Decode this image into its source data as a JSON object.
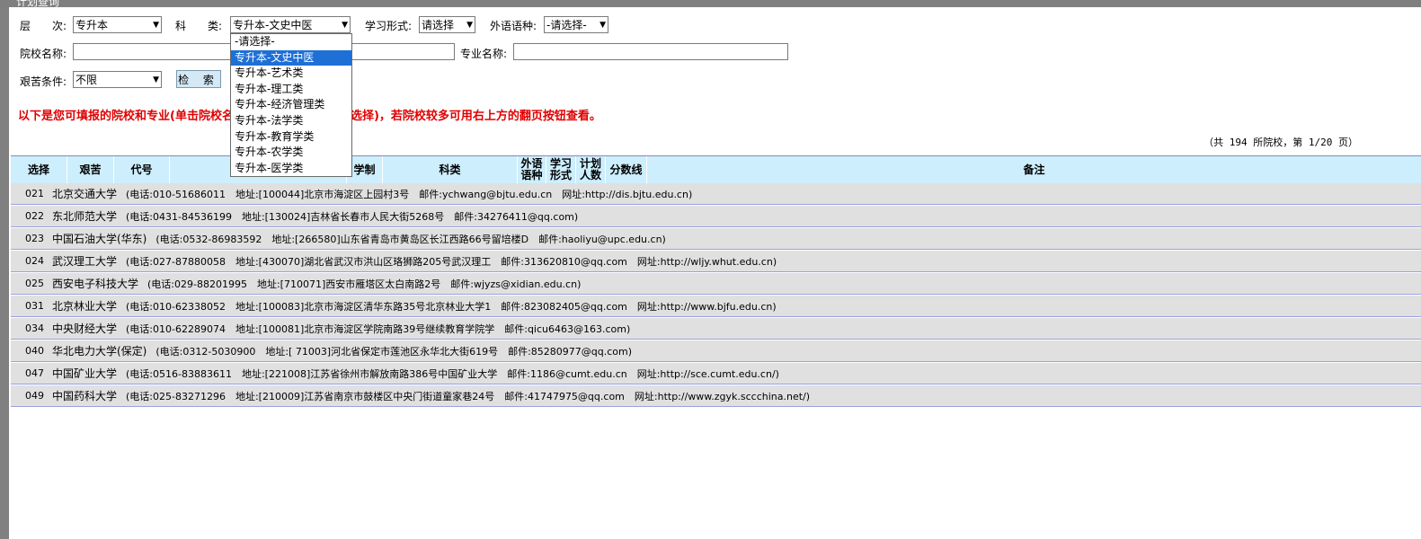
{
  "window_title": "计划查询",
  "filters": {
    "level_label": "层　　次:",
    "level_value": "专升本",
    "category_label": "科　　类:",
    "category_value": "专升本-文史中医",
    "study_form_label": "学习形式:",
    "study_form_value": "请选择",
    "language_label": "外语语种:",
    "language_value": "-请选择-",
    "school_label": "院校名称:",
    "school_value": "",
    "major_label": "专业名称:",
    "major_value": "",
    "hardship_label": "艰苦条件:",
    "hardship_value": "不限",
    "search_button": "检 索"
  },
  "category_options": [
    "-请选择-",
    "专升本-文史中医",
    "专升本-艺术类",
    "专升本-理工类",
    "专升本-经济管理类",
    "专升本-法学类",
    "专升本-教育学类",
    "专升本-农学类",
    "专升本-医学类"
  ],
  "selected_option_index": 1,
  "notice": "以下是您可填报的院校和专业(单击院校名称查看专业，双击专业选择)，若院校较多可用右上方的翻页按钮查看。",
  "page_info": "（共 194 所院校，第 1/20 页）",
  "table": {
    "headers": [
      "选择",
      "艰苦",
      "代号",
      "",
      "学制",
      "科类",
      "外语\n语种",
      "学习\n形式",
      "计划\n人数",
      "分数线",
      "备注"
    ],
    "rows": [
      {
        "code": "021",
        "name": "北京交通大学",
        "info": "(电话:010-51686011　地址:[100044]北京市海淀区上园村3号　邮件:ychwang@bjtu.edu.cn　网址:http://dis.bjtu.edu.cn)"
      },
      {
        "code": "022",
        "name": "东北师范大学",
        "info": "(电话:0431-84536199　地址:[130024]吉林省长春市人民大街5268号　邮件:34276411@qq.com)"
      },
      {
        "code": "023",
        "name": "中国石油大学(华东)",
        "info": "(电话:0532-86983592　地址:[266580]山东省青岛市黄岛区长江西路66号留培楼D　邮件:haoliyu@upc.edu.cn)"
      },
      {
        "code": "024",
        "name": "武汉理工大学",
        "info": "(电话:027-87880058　地址:[430070]湖北省武汉市洪山区珞狮路205号武汉理工　邮件:313620810@qq.com　网址:http://wljy.whut.edu.cn)"
      },
      {
        "code": "025",
        "name": "西安电子科技大学",
        "info": "(电话:029-88201995　地址:[710071]西安市雁塔区太白南路2号　邮件:wjyzs@xidian.edu.cn)"
      },
      {
        "code": "031",
        "name": "北京林业大学",
        "info": "(电话:010-62338052　地址:[100083]北京市海淀区清华东路35号北京林业大学1　邮件:823082405@qq.com　网址:http://www.bjfu.edu.cn)"
      },
      {
        "code": "034",
        "name": "中央财经大学",
        "info": "(电话:010-62289074　地址:[100081]北京市海淀区学院南路39号继续教育学院学　邮件:qicu6463@163.com)"
      },
      {
        "code": "040",
        "name": "华北电力大学(保定)",
        "info": "(电话:0312-5030900　地址:[ 71003]河北省保定市莲池区永华北大街619号　邮件:85280977@qq.com)"
      },
      {
        "code": "047",
        "name": "中国矿业大学",
        "info": "(电话:0516-83883611　地址:[221008]江苏省徐州市解放南路386号中国矿业大学　邮件:1186@cumt.edu.cn　网址:http://sce.cumt.edu.cn/)"
      },
      {
        "code": "049",
        "name": "中国药科大学",
        "info": "(电话:025-83271296　地址:[210009]江苏省南京市鼓楼区中央门街道童家巷24号　邮件:41747975@qq.com　网址:http://www.zgyk.sccchina.net/)"
      }
    ]
  }
}
